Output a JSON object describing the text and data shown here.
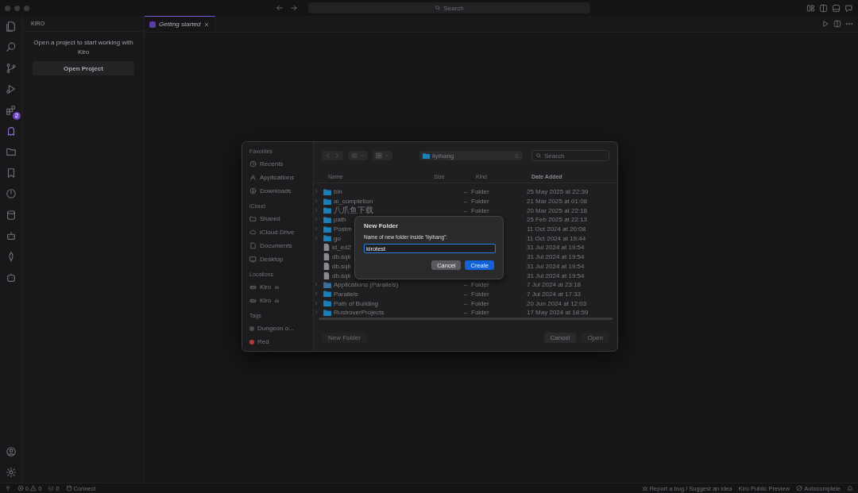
{
  "window": {
    "search_placeholder": "Search"
  },
  "activity_bar": {
    "items": [
      {
        "kind": "files",
        "selected": false
      },
      {
        "kind": "search",
        "selected": false
      },
      {
        "kind": "branch",
        "selected": false
      },
      {
        "kind": "run",
        "selected": false
      },
      {
        "kind": "extensions",
        "selected": false,
        "badge": "2"
      },
      {
        "kind": "ghost",
        "selected": true
      },
      {
        "kind": "folder",
        "selected": false
      },
      {
        "kind": "bookmark",
        "selected": false
      },
      {
        "kind": "power",
        "selected": false
      },
      {
        "kind": "database",
        "selected": false
      },
      {
        "kind": "robot",
        "selected": false
      },
      {
        "kind": "leaf",
        "selected": false
      },
      {
        "kind": "bot",
        "selected": false
      }
    ],
    "bottom": [
      {
        "kind": "account",
        "selected": false
      },
      {
        "kind": "settings",
        "selected": false
      }
    ]
  },
  "sidebar": {
    "title": "KIRO",
    "message": "Open a project to start working with Kiro",
    "button": "Open Project"
  },
  "tabs": [
    {
      "label": "Getting started",
      "selected": true
    }
  ],
  "open_panel": {
    "sidebar": [
      {
        "heading": "Favorites",
        "items": [
          {
            "label": "Recents",
            "kind": "clock"
          },
          {
            "label": "Applications",
            "kind": "apps"
          },
          {
            "label": "Downloads",
            "kind": "download"
          }
        ]
      },
      {
        "heading": "iCloud",
        "items": [
          {
            "label": "Shared",
            "kind": "shared"
          },
          {
            "label": "iCloud Drive",
            "kind": "cloud"
          },
          {
            "label": "Documents",
            "kind": "doc"
          },
          {
            "label": "Desktop",
            "kind": "desktop"
          }
        ]
      },
      {
        "heading": "Locations",
        "items": [
          {
            "label": "Kiro",
            "kind": "disk"
          },
          {
            "label": "Kiro",
            "kind": "disk"
          }
        ]
      },
      {
        "heading": "Tags",
        "items": [
          {
            "label": "Dungeon o...",
            "kind": "tag",
            "color": "#4a4a4a"
          },
          {
            "label": "Red",
            "kind": "tag",
            "color": "#b03a3a"
          }
        ]
      }
    ],
    "location": "liyihang",
    "search_placeholder": "Search",
    "columns": [
      {
        "label": "Name",
        "sorted": false
      },
      {
        "label": "Size",
        "sorted": false
      },
      {
        "label": "Kind",
        "sorted": false
      },
      {
        "label": "Date Added",
        "sorted": true
      }
    ],
    "rows": [
      {
        "name": "bin",
        "kind": "folder",
        "size": "--",
        "kind_label": "Folder",
        "date": "25 May 2025 at 22:39"
      },
      {
        "name": "ai_completion",
        "kind": "folder",
        "size": "--",
        "kind_label": "Folder",
        "date": "21 Mar 2025 at 01:08"
      },
      {
        "name": "八爪鱼下载",
        "kind": "folder",
        "size": "--",
        "kind_label": "Folder",
        "date": "20 Mar 2025 at 22:18"
      },
      {
        "name": "path",
        "kind": "folder",
        "date": "25 Feb 2025 at 22:13"
      },
      {
        "name": "Postm",
        "kind": "folder",
        "date": "11 Oct 2024 at 20:08"
      },
      {
        "name": "go",
        "kind": "folder",
        "date": "11 Oct 2024 at 19:44"
      },
      {
        "name": "id_ed2",
        "kind": "file",
        "date": "31 Jul 2024 at 19:54"
      },
      {
        "name": "db.sqli",
        "kind": "file",
        "date": "31 Jul 2024 at 19:54"
      },
      {
        "name": "db.sqli",
        "kind": "file",
        "date": "31 Jul 2024 at 19:54"
      },
      {
        "name": "db.sqli",
        "kind": "file",
        "date": "31 Jul 2024 at 19:54"
      },
      {
        "name": "Applications (Parallels)",
        "kind": "app_folder",
        "size": "--",
        "kind_label": "Folder",
        "date": "7 Jul 2024 at 23:18"
      },
      {
        "name": "Parallels",
        "kind": "folder",
        "size": "--",
        "kind_label": "Folder",
        "date": "7 Jul 2024 at 17:33"
      },
      {
        "name": "Path of Building",
        "kind": "folder",
        "size": "--",
        "kind_label": "Folder",
        "date": "20 Jun 2024 at 12:03"
      },
      {
        "name": "RustroverProjects",
        "kind": "folder",
        "size": "--",
        "kind_label": "Folder",
        "date": "17 May 2024 at 18:59"
      }
    ],
    "buttons": [
      {
        "label": "New Folder",
        "disabled": true
      },
      {
        "label": "Cancel",
        "disabled": false
      },
      {
        "label": "Open",
        "disabled": true
      }
    ]
  },
  "new_folder_sheet": {
    "title": "New Folder",
    "prompt": "Name of new folder inside “liyihang”:",
    "value": "kirotest",
    "buttons": [
      {
        "label": "Cancel",
        "kind": "secondary"
      },
      {
        "label": "Create",
        "kind": "primary"
      }
    ]
  },
  "status_bar": {
    "errors": "0",
    "warnings": "0",
    "ports": "0",
    "connect": "Connect",
    "report": "Report a bug / Suggest an idea",
    "preview": "Kiro Public Preview",
    "autocomplete": "Autocomplete"
  }
}
